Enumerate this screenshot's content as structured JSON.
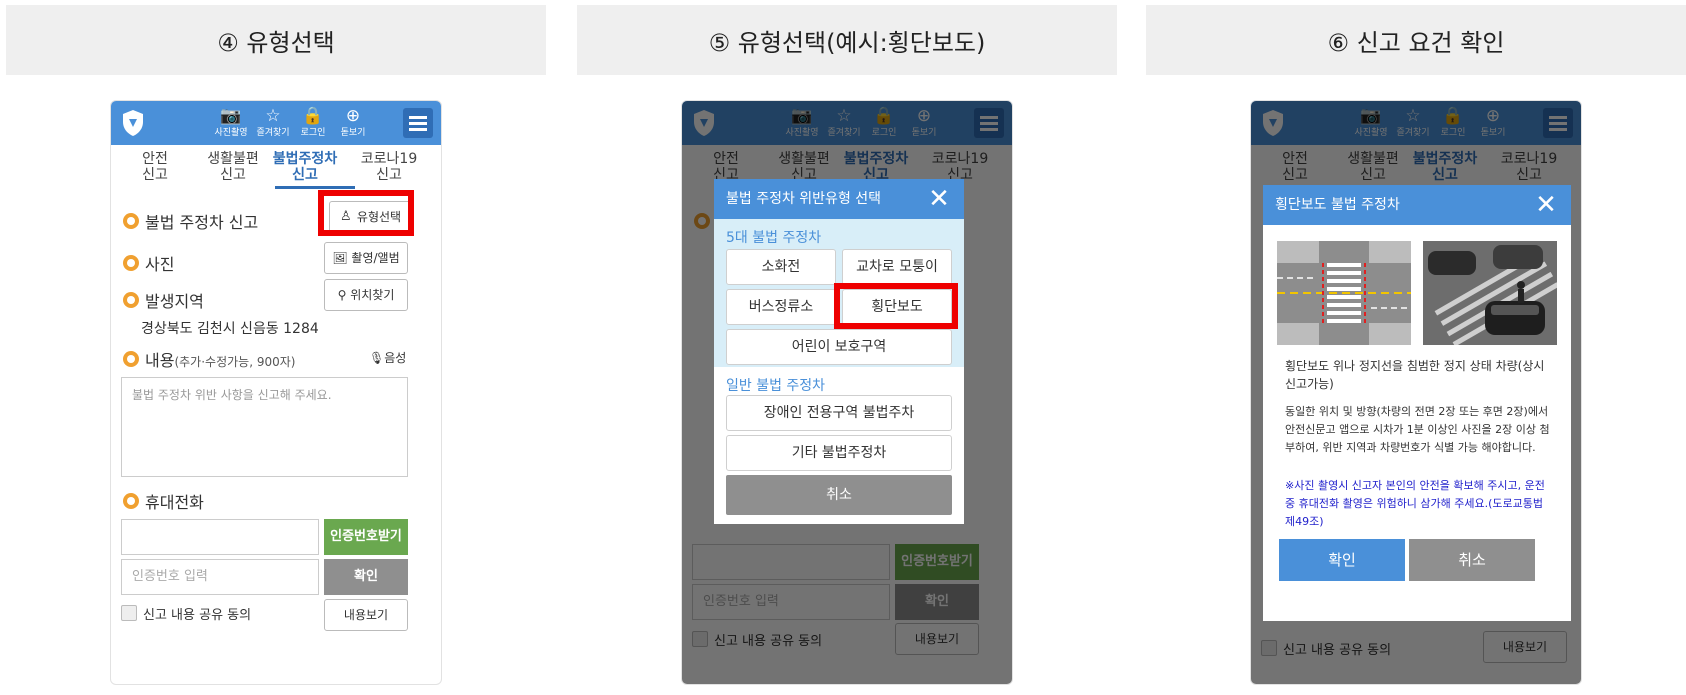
{
  "steps": [
    {
      "title": "④ 유형선택"
    },
    {
      "title": "⑤ 유형선택(예시:횡단보도)"
    },
    {
      "title": "⑥ 신고 요건 확인"
    }
  ],
  "app": {
    "top_icons": [
      {
        "icon": "camera-icon",
        "glyph": "📷",
        "label": "사진촬영"
      },
      {
        "icon": "star-icon",
        "glyph": "☆",
        "label": "즐겨찾기"
      },
      {
        "icon": "lock-icon",
        "glyph": "🔒",
        "label": "로그인"
      },
      {
        "icon": "zoom-icon",
        "glyph": "⊕",
        "label": "돋보기"
      }
    ],
    "tabs": [
      {
        "line1": "안전",
        "line2": "신고"
      },
      {
        "line1": "생활불편",
        "line2": "신고"
      },
      {
        "line1": "불법주정차",
        "line2": "신고"
      },
      {
        "line1": "코로나19",
        "line2": "신고"
      }
    ],
    "form": {
      "report_title": "불법 주정차 신고",
      "type_button": "유형선택",
      "photo_label": "사진",
      "photo_button": "촬영/앨범",
      "location_label": "발생지역",
      "location_button": "위치찾기",
      "address": "경상북도 김천시 신음동 1284",
      "content_label": "내용",
      "content_hint": "(추가·수정가능, 900자)",
      "voice_button": "음성",
      "content_placeholder": "불법 주정차 위반 사항을 신고해 주세요.",
      "phone_label": "휴대전화",
      "get_code_button": "인증번호받기",
      "code_placeholder": "인증번호 입력",
      "confirm_button": "확인",
      "share_label": "신고 내용 공유 동의",
      "view_button": "내용보기"
    }
  },
  "type_modal": {
    "title": "불법 주정차 위반유형 선택",
    "group1_label": "5대 불법 주정차",
    "group1_options": [
      "소화전",
      "교차로 모퉁이",
      "버스정류소",
      "횡단보도",
      "어린이 보호구역"
    ],
    "group2_label": "일반 불법 주정차",
    "group2_options": [
      "장애인 전용구역 불법주차",
      "기타 불법주정차"
    ],
    "cancel": "취소"
  },
  "confirm_modal": {
    "title": "횡단보도 불법 주정차",
    "desc1": "횡단보도 위나 정지선을 침범한 정지 상태 차량(상시 신고가능)",
    "desc2": "동일한 위치 및 방향(차량의 전면 2장 또는 후면 2장)에서 안전신문고 앱으로 시차가 1분 이상인 사진을 2장 이상 첨부하여, 위반 지역과 차량번호가 식별 가능 해야합니다.",
    "note": "※사진 촬영시 신고자 본인의 안전을 확보해 주시고, 운전 중 휴대전화 촬영은 위험하니 삼가해 주세요.(도로교통법 제49조)",
    "confirm": "확인",
    "cancel": "취소"
  },
  "colors": {
    "brand_blue": "#4a90d9",
    "dark_blue": "#2f6db5",
    "green": "#6aa84f",
    "highlight_red": "#ee0000",
    "bullet_orange": "#f0a030"
  }
}
